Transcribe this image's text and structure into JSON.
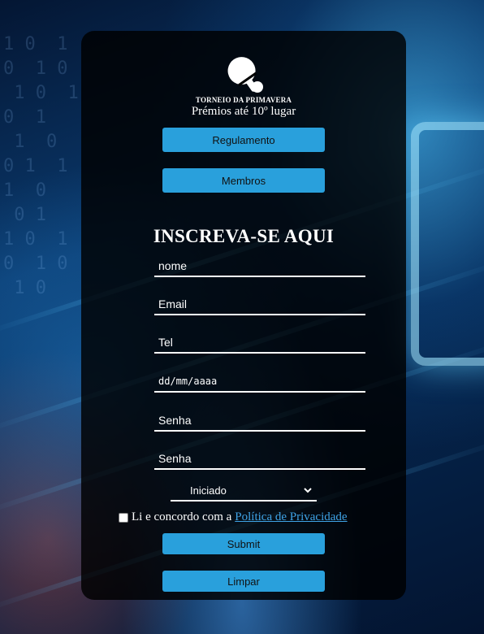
{
  "brand": {
    "title": "TORNEIO DA PRIMAVERA",
    "subtitle": "Prémios até 10º lugar",
    "logo_icon": "ping-pong-paddle-icon"
  },
  "nav": {
    "rules_label": "Regulamento",
    "members_label": "Membros"
  },
  "form": {
    "heading": "INSCREVA-SE AQUI",
    "name_placeholder": "nome",
    "email_placeholder": "Email",
    "phone_placeholder": "Tel",
    "date_placeholder": "dd/mm/aaaa",
    "password_placeholder": "Senha",
    "password_confirm_placeholder": "Senha",
    "level_selected": "Iniciado",
    "consent_text": "Li e concordo com a",
    "consent_link": "Política de Privacidade",
    "submit_label": "Submit",
    "reset_label": "Limpar"
  },
  "colors": {
    "accent": "#29a0dc",
    "link": "#3fa3e6",
    "card_bg": "rgba(0,0,0,0.82)"
  }
}
